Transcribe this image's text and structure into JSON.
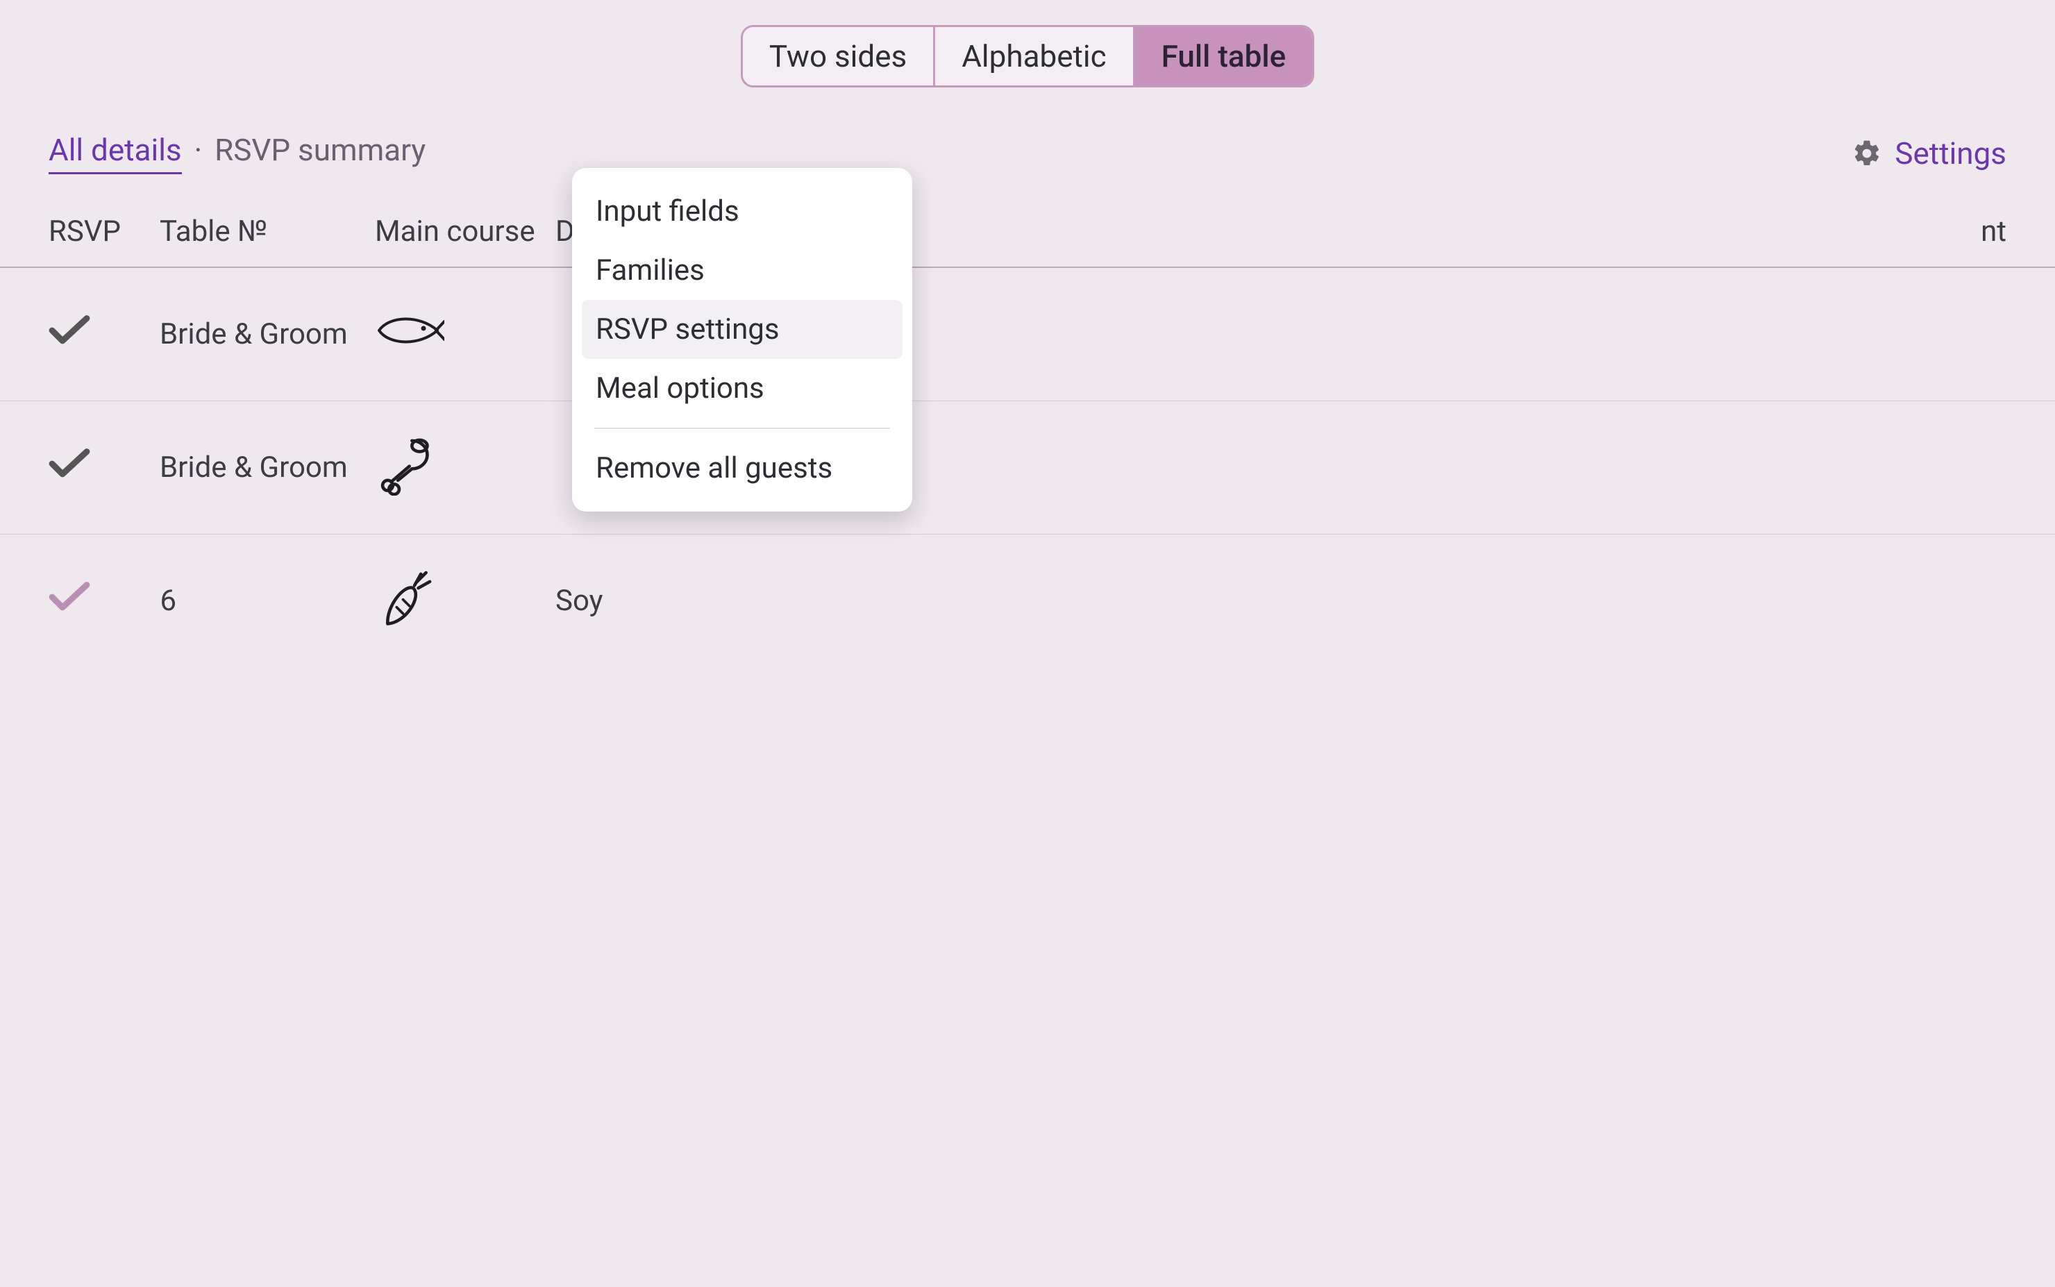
{
  "segmented": {
    "items": [
      "Two sides",
      "Alphabetic",
      "Full table"
    ],
    "active_index": 2
  },
  "subnav": {
    "all_details": "All details",
    "rsvp_summary": "RSVP summary",
    "separator": "·"
  },
  "settings": {
    "label": "Settings",
    "menu": {
      "input_fields": "Input fields",
      "families": "Families",
      "rsvp_settings": "RSVP settings",
      "meal_options": "Meal options",
      "remove_all_guests": "Remove all guests"
    },
    "hovered_item": "rsvp_settings"
  },
  "columns": {
    "rsvp": "RSVP",
    "table_no": "Table №",
    "main_course": "Main course",
    "dietary_partial": "D",
    "trailing_partial": "nt"
  },
  "rows": [
    {
      "rsvp": true,
      "rsvp_style": "dark",
      "table": "Bride & Groom",
      "main_course_icon": "fish",
      "dietary": ""
    },
    {
      "rsvp": true,
      "rsvp_style": "dark",
      "table": "Bride & Groom",
      "main_course_icon": "meat",
      "dietary": ""
    },
    {
      "rsvp": true,
      "rsvp_style": "light",
      "table": "6",
      "main_course_icon": "carrot",
      "dietary": "Soy"
    }
  ]
}
